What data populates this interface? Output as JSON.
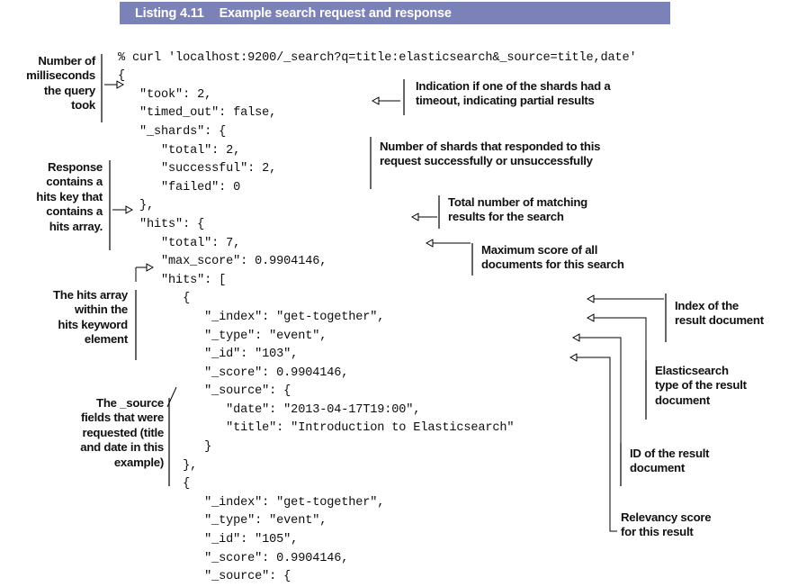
{
  "listing": {
    "number": "Listing 4.11",
    "title": "Example search request and response",
    "bar_color": "#7b82b8"
  },
  "code": {
    "text": "% curl 'localhost:9200/_search?q=title:elasticsearch&_source=title,date'\n{\n   \"took\": 2,\n   \"timed_out\": false,\n   \"_shards\": {\n      \"total\": 2,\n      \"successful\": 2,\n      \"failed\": 0\n   },\n   \"hits\": {\n      \"total\": 7,\n      \"max_score\": 0.9904146,\n      \"hits\": [\n         {\n            \"_index\": \"get-together\",\n            \"_type\": \"event\",\n            \"_id\": \"103\",\n            \"_score\": 0.9904146,\n            \"_source\": {\n               \"date\": \"2013-04-17T19:00\",\n               \"title\": \"Introduction to Elasticsearch\"\n            }\n         },\n         {\n            \"_index\": \"get-together\",\n            \"_type\": \"event\",\n            \"_id\": \"105\",\n            \"_score\": 0.9904146,\n            \"_source\": {"
  },
  "annotations": {
    "took": "Number of\nmilliseconds\nthe query\ntook",
    "hits_key": "Response\ncontains a\nhits key that\ncontains a\nhits array.",
    "hits_array": "The hits array\nwithin the\nhits keyword\nelement",
    "source_fields": "The _source\nfields that were\nrequested (title\nand date in this\nexample)",
    "timed_out": "Indication if one of the shards had a\ntimeout, indicating partial results",
    "shards": "Number of shards that responded to this\nrequest successfully or unsuccessfully",
    "total_hits": "Total number of matching\nresults for the search",
    "max_score": "Maximum score of all\ndocuments for this search",
    "index": "Index of the\nresult document",
    "type": "Elasticsearch\ntype of the result\ndocument",
    "id": "ID of the result\ndocument",
    "score": "Relevancy score\nfor this result"
  }
}
